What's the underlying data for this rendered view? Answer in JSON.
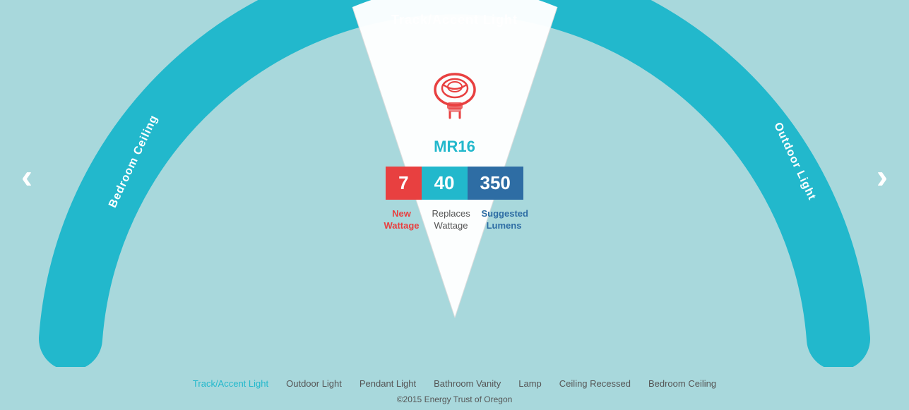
{
  "page": {
    "background_color": "#a8d8dc"
  },
  "arc": {
    "top_label": "Track/Accent Light",
    "left_label": "Bedroom Ceiling",
    "right_label": "Outdoor Light",
    "arc_color": "#22b8cc"
  },
  "nav": {
    "left_arrow": "‹",
    "right_arrow": "›"
  },
  "bulb": {
    "name": "MR16",
    "icon_alt": "MR16 bulb icon"
  },
  "stats": [
    {
      "value": "7",
      "label_line1": "New",
      "label_line2": "Wattage",
      "color": "red"
    },
    {
      "value": "40",
      "label_line1": "Replaces",
      "label_line2": "Wattage",
      "color": "cyan"
    },
    {
      "value": "350",
      "label_line1": "Suggested",
      "label_line2": "Lumens",
      "color": "navy"
    }
  ],
  "bottom_links": [
    {
      "label": "Track/Accent Light",
      "active": true
    },
    {
      "label": "Outdoor Light",
      "active": false
    },
    {
      "label": "Pendant Light",
      "active": false
    },
    {
      "label": "Bathroom Vanity",
      "active": false
    },
    {
      "label": "Lamp",
      "active": false
    },
    {
      "label": "Ceiling Recessed",
      "active": false
    },
    {
      "label": "Bedroom Ceiling",
      "active": false
    }
  ],
  "copyright": "©2015 Energy Trust of Oregon"
}
